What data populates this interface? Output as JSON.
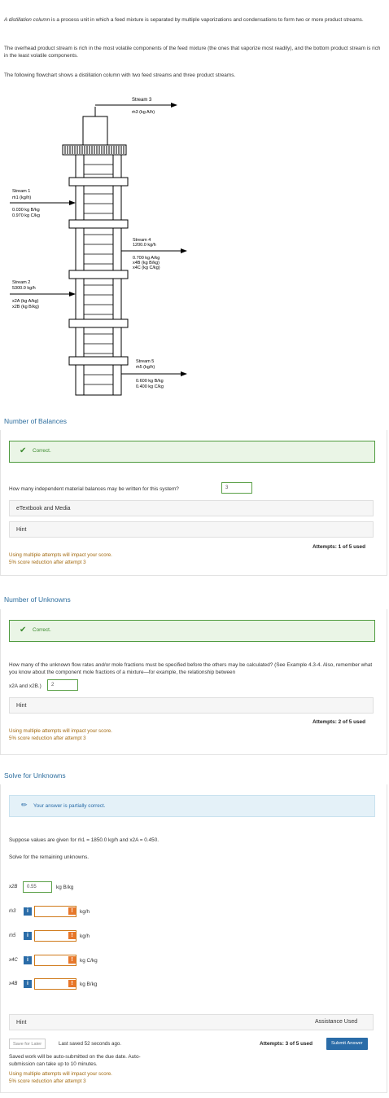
{
  "intro": {
    "p1_em": "A distillation column",
    "p1_rest": " is a process unit in which a feed mixture is separated by multiple vaporizations and condensations to form two or more product streams.",
    "p2": "The overhead product stream is rich in the most volatile components of the feed mixture (the ones that vaporize most readily), and the bottom product stream is rich in the least volatile components.",
    "p3": "The following flowchart shows a distillation column with two feed streams and three product streams."
  },
  "diagram": {
    "stream3_title": "Stream 3",
    "stream3_flow": "ṁ3 (kg A/h)",
    "stream1_title": "Stream 1",
    "stream1_flow": "ṁ1 (kg/h)",
    "stream1_c1": "0.030 kg B/kg",
    "stream1_c2": "0.970 kg C/kg",
    "stream2_title": "Stream 2",
    "stream2_flow": "5300.0 kg/h",
    "stream2_c1": "x2A (kg A/kg)",
    "stream2_c2": "x2B (kg B/kg)",
    "stream4_title": "Stream 4",
    "stream4_flow": "1200.0 kg/h",
    "stream4_c1": "0.700 kg A/kg",
    "stream4_c2": "x4B (kg B/kg)",
    "stream4_c3": "x4C (kg C/kg)",
    "stream5_title": "Stream 5",
    "stream5_flow": "ṁ5 (kg/h)",
    "stream5_c1": "0.600 kg B/kg",
    "stream5_c2": "0.400 kg C/kg"
  },
  "section1": {
    "title": "Number of Balances",
    "status": "Correct.",
    "question": "How many independent material balances may be written for this system?",
    "answer": "3",
    "etext": "eTextbook and Media",
    "hint": "Hint",
    "warn1": "Using multiple attempts will impact your score.",
    "warn2": "5% score reduction after attempt 3",
    "attempts": "Attempts: 1 of 5 used"
  },
  "section2": {
    "title": "Number of Unknowns",
    "status": "Correct.",
    "question": "How many of the unknown flow rates and/or mole fractions must be specified before the others may be calculated? (See Example 4.3-4. Also, remember what you know about the component mole fractions of a mixture—for example, the relationship between",
    "question_end": "x2A and x2B.)",
    "answer": "2",
    "hint": "Hint",
    "warn1": "Using multiple attempts will impact your score.",
    "warn2": "5% score reduction after attempt 3",
    "attempts": "Attempts: 2 of 5 used"
  },
  "section3": {
    "title": "Solve for Unknowns",
    "status": "Your answer is partially correct.",
    "prompt": "Suppose values are given for ṁ1 = 1850.0 kg/h and x2A = 0.450.",
    "prompt2": "Solve for the remaining unknowns.",
    "rows": [
      {
        "var": "x2B",
        "value": "0.55",
        "unit": "kg B/kg"
      },
      {
        "var": "ṁ3",
        "value": "",
        "unit": "kg/h"
      },
      {
        "var": "ṁ5",
        "value": "",
        "unit": "kg/h"
      },
      {
        "var": "x4C",
        "value": "",
        "unit": "kg C/kg"
      },
      {
        "var": "x4B",
        "value": "",
        "unit": "kg B/kg"
      }
    ],
    "hint": "Hint",
    "assistance": "Assistance Used",
    "save_later": "Save for Later",
    "last_saved": "Last saved 52 seconds ago.",
    "auto1": "Saved work will be auto-submitted on the due date. Auto-",
    "auto2": "submission can take up to 10 minutes.",
    "warn1": "Using multiple attempts will impact your score.",
    "warn2": "5% score reduction after attempt 3",
    "attempts": "Attempts: 3 of 5 used",
    "submit": "Submit Answer"
  },
  "colors": {
    "section_title": "#2f6f9f",
    "correct_green": "#3c8a2e",
    "partial_blue": "#2a6ca8",
    "warn_orange": "#e8772a"
  }
}
